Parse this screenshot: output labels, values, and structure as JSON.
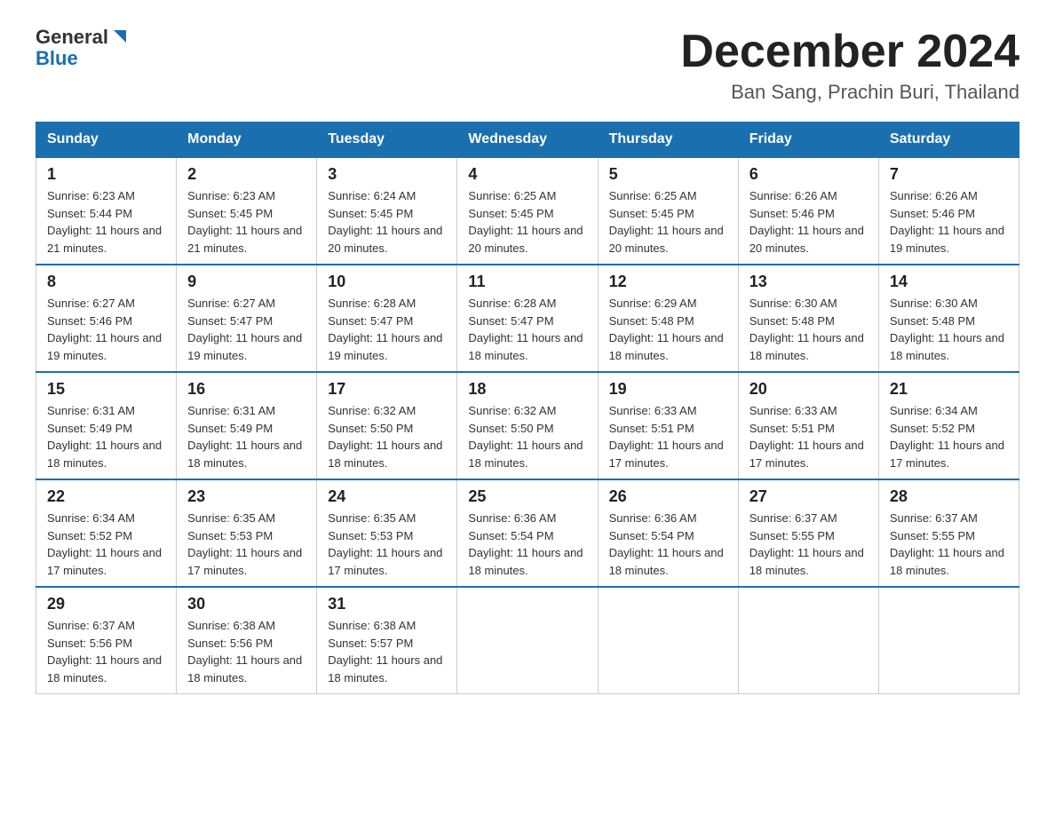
{
  "logo": {
    "general": "General",
    "arrow": "▶",
    "blue": "Blue"
  },
  "header": {
    "month_year": "December 2024",
    "location": "Ban Sang, Prachin Buri, Thailand"
  },
  "weekdays": [
    "Sunday",
    "Monday",
    "Tuesday",
    "Wednesday",
    "Thursday",
    "Friday",
    "Saturday"
  ],
  "weeks": [
    [
      {
        "day": "1",
        "sunrise": "6:23 AM",
        "sunset": "5:44 PM",
        "daylight": "11 hours and 21 minutes."
      },
      {
        "day": "2",
        "sunrise": "6:23 AM",
        "sunset": "5:45 PM",
        "daylight": "11 hours and 21 minutes."
      },
      {
        "day": "3",
        "sunrise": "6:24 AM",
        "sunset": "5:45 PM",
        "daylight": "11 hours and 20 minutes."
      },
      {
        "day": "4",
        "sunrise": "6:25 AM",
        "sunset": "5:45 PM",
        "daylight": "11 hours and 20 minutes."
      },
      {
        "day": "5",
        "sunrise": "6:25 AM",
        "sunset": "5:45 PM",
        "daylight": "11 hours and 20 minutes."
      },
      {
        "day": "6",
        "sunrise": "6:26 AM",
        "sunset": "5:46 PM",
        "daylight": "11 hours and 20 minutes."
      },
      {
        "day": "7",
        "sunrise": "6:26 AM",
        "sunset": "5:46 PM",
        "daylight": "11 hours and 19 minutes."
      }
    ],
    [
      {
        "day": "8",
        "sunrise": "6:27 AM",
        "sunset": "5:46 PM",
        "daylight": "11 hours and 19 minutes."
      },
      {
        "day": "9",
        "sunrise": "6:27 AM",
        "sunset": "5:47 PM",
        "daylight": "11 hours and 19 minutes."
      },
      {
        "day": "10",
        "sunrise": "6:28 AM",
        "sunset": "5:47 PM",
        "daylight": "11 hours and 19 minutes."
      },
      {
        "day": "11",
        "sunrise": "6:28 AM",
        "sunset": "5:47 PM",
        "daylight": "11 hours and 18 minutes."
      },
      {
        "day": "12",
        "sunrise": "6:29 AM",
        "sunset": "5:48 PM",
        "daylight": "11 hours and 18 minutes."
      },
      {
        "day": "13",
        "sunrise": "6:30 AM",
        "sunset": "5:48 PM",
        "daylight": "11 hours and 18 minutes."
      },
      {
        "day": "14",
        "sunrise": "6:30 AM",
        "sunset": "5:48 PM",
        "daylight": "11 hours and 18 minutes."
      }
    ],
    [
      {
        "day": "15",
        "sunrise": "6:31 AM",
        "sunset": "5:49 PM",
        "daylight": "11 hours and 18 minutes."
      },
      {
        "day": "16",
        "sunrise": "6:31 AM",
        "sunset": "5:49 PM",
        "daylight": "11 hours and 18 minutes."
      },
      {
        "day": "17",
        "sunrise": "6:32 AM",
        "sunset": "5:50 PM",
        "daylight": "11 hours and 18 minutes."
      },
      {
        "day": "18",
        "sunrise": "6:32 AM",
        "sunset": "5:50 PM",
        "daylight": "11 hours and 18 minutes."
      },
      {
        "day": "19",
        "sunrise": "6:33 AM",
        "sunset": "5:51 PM",
        "daylight": "11 hours and 17 minutes."
      },
      {
        "day": "20",
        "sunrise": "6:33 AM",
        "sunset": "5:51 PM",
        "daylight": "11 hours and 17 minutes."
      },
      {
        "day": "21",
        "sunrise": "6:34 AM",
        "sunset": "5:52 PM",
        "daylight": "11 hours and 17 minutes."
      }
    ],
    [
      {
        "day": "22",
        "sunrise": "6:34 AM",
        "sunset": "5:52 PM",
        "daylight": "11 hours and 17 minutes."
      },
      {
        "day": "23",
        "sunrise": "6:35 AM",
        "sunset": "5:53 PM",
        "daylight": "11 hours and 17 minutes."
      },
      {
        "day": "24",
        "sunrise": "6:35 AM",
        "sunset": "5:53 PM",
        "daylight": "11 hours and 17 minutes."
      },
      {
        "day": "25",
        "sunrise": "6:36 AM",
        "sunset": "5:54 PM",
        "daylight": "11 hours and 18 minutes."
      },
      {
        "day": "26",
        "sunrise": "6:36 AM",
        "sunset": "5:54 PM",
        "daylight": "11 hours and 18 minutes."
      },
      {
        "day": "27",
        "sunrise": "6:37 AM",
        "sunset": "5:55 PM",
        "daylight": "11 hours and 18 minutes."
      },
      {
        "day": "28",
        "sunrise": "6:37 AM",
        "sunset": "5:55 PM",
        "daylight": "11 hours and 18 minutes."
      }
    ],
    [
      {
        "day": "29",
        "sunrise": "6:37 AM",
        "sunset": "5:56 PM",
        "daylight": "11 hours and 18 minutes."
      },
      {
        "day": "30",
        "sunrise": "6:38 AM",
        "sunset": "5:56 PM",
        "daylight": "11 hours and 18 minutes."
      },
      {
        "day": "31",
        "sunrise": "6:38 AM",
        "sunset": "5:57 PM",
        "daylight": "11 hours and 18 minutes."
      },
      null,
      null,
      null,
      null
    ]
  ]
}
